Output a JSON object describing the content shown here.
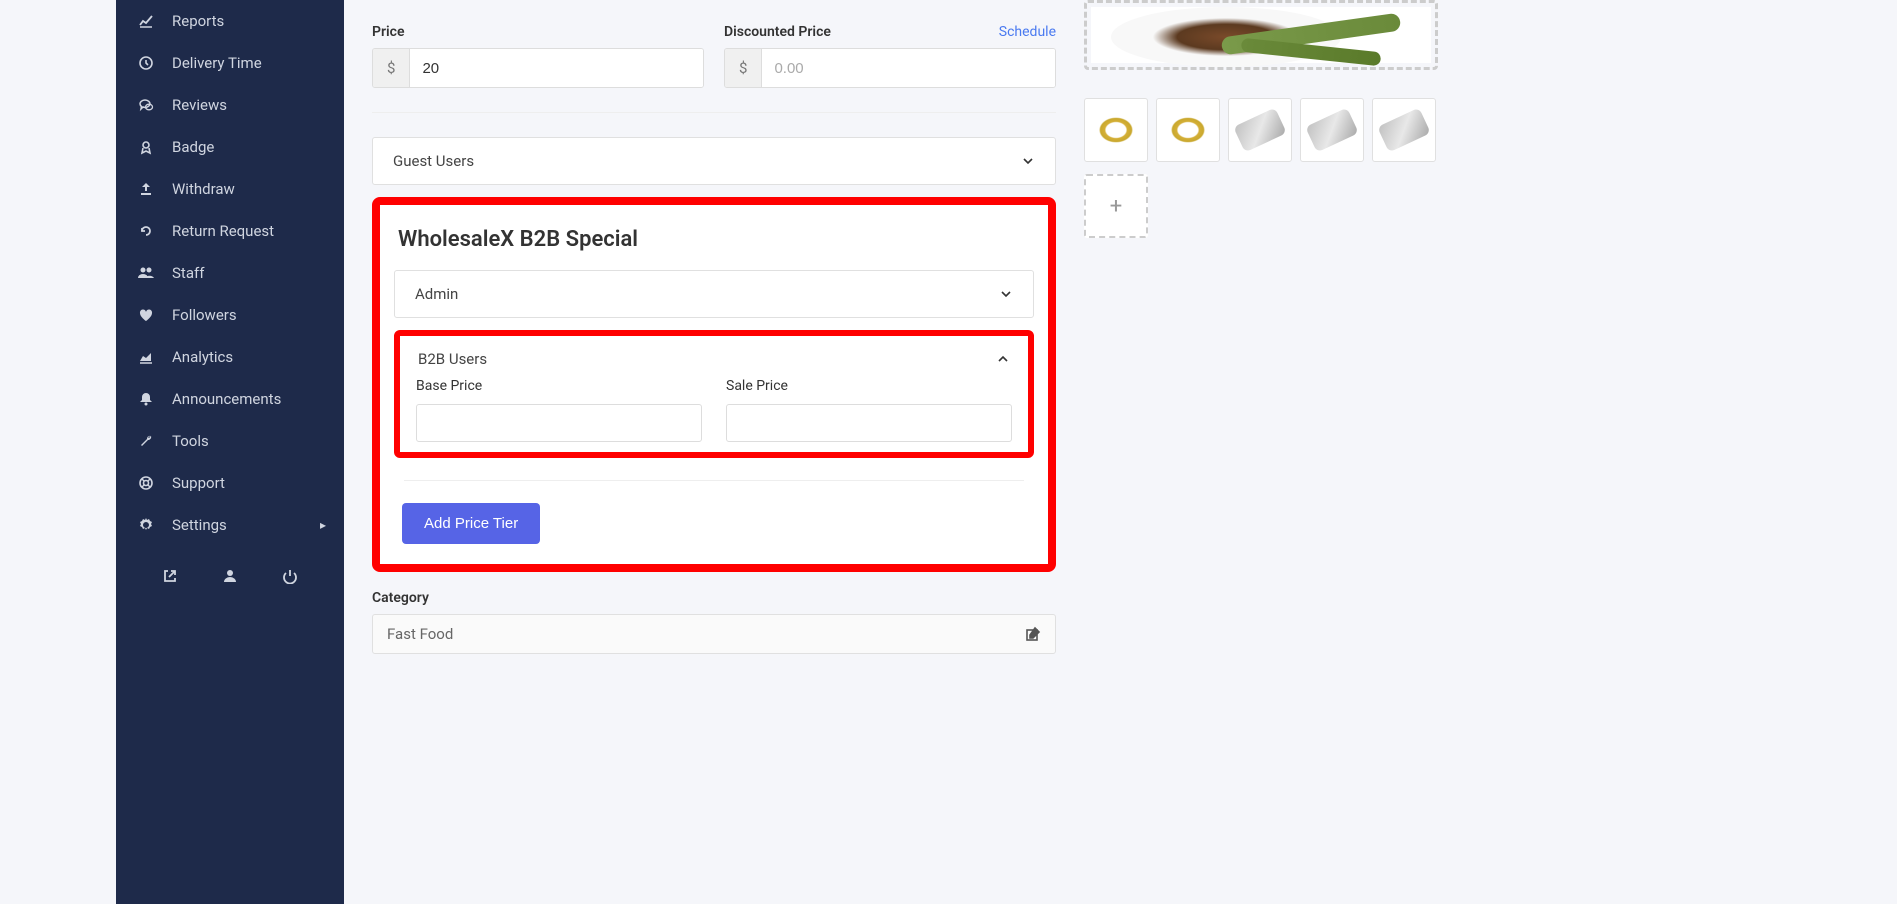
{
  "sidebar": {
    "items": [
      {
        "label": "Reports",
        "icon": "chart"
      },
      {
        "label": "Delivery Time",
        "icon": "clock"
      },
      {
        "label": "Reviews",
        "icon": "chat"
      },
      {
        "label": "Badge",
        "icon": "badge"
      },
      {
        "label": "Withdraw",
        "icon": "upload"
      },
      {
        "label": "Return Request",
        "icon": "undo"
      },
      {
        "label": "Staff",
        "icon": "users"
      },
      {
        "label": "Followers",
        "icon": "heart"
      },
      {
        "label": "Analytics",
        "icon": "area"
      },
      {
        "label": "Announcements",
        "icon": "bell"
      },
      {
        "label": "Tools",
        "icon": "wrench"
      },
      {
        "label": "Support",
        "icon": "life-ring"
      },
      {
        "label": "Settings",
        "icon": "gear",
        "has_submenu": true
      }
    ]
  },
  "pricing": {
    "price_label": "Price",
    "price_value": "20",
    "discounted_label": "Discounted Price",
    "discounted_placeholder": "0.00",
    "schedule_label": "Schedule",
    "currency": "$"
  },
  "guest_users_label": "Guest Users",
  "wholesalex": {
    "title": "WholesaleX B2B Special",
    "admin_label": "Admin",
    "b2b_label": "B2B Users",
    "base_price_label": "Base Price",
    "sale_price_label": "Sale Price",
    "add_tier_label": "Add Price Tier"
  },
  "category": {
    "label": "Category",
    "value": "Fast Food"
  },
  "images": {
    "add_label": "+"
  }
}
